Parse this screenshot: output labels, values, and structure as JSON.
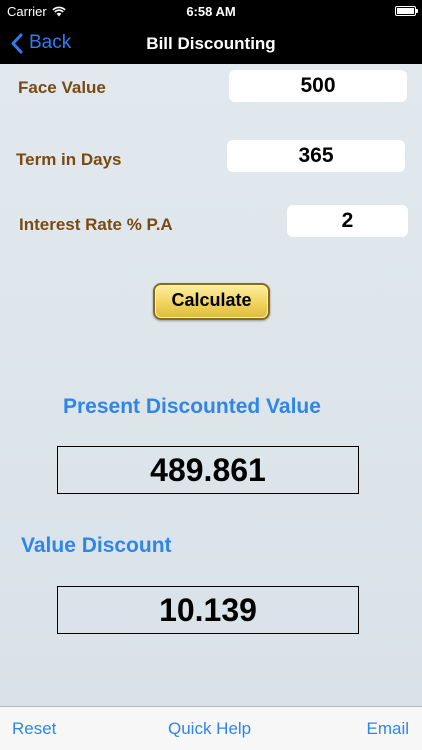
{
  "status_bar": {
    "carrier": "Carrier",
    "time": "6:58 AM"
  },
  "nav": {
    "back_label": "Back",
    "title": "Bill Discounting"
  },
  "form": {
    "face_value": {
      "label": "Face Value",
      "value": "500"
    },
    "term_days": {
      "label": "Term in Days",
      "value": "365"
    },
    "interest_rate": {
      "label": "Interest Rate % P.A",
      "value": "2"
    },
    "calculate_label": "Calculate"
  },
  "results": {
    "present_value": {
      "label": "Present Discounted Value",
      "value": "489.861"
    },
    "value_discount": {
      "label": "Value Discount",
      "value": "10.139"
    }
  },
  "tab_bar": {
    "reset_label": "Reset",
    "help_label": "Quick Help",
    "email_label": "Email"
  },
  "colors": {
    "accent": "#2f86e8",
    "label_brown": "#7a4a14",
    "button_gold": "#f1d45e"
  }
}
